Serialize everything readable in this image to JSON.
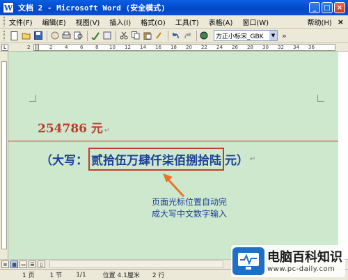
{
  "window": {
    "title": "文档 2 - Microsoft Word (安全模式)",
    "app_icon": "W",
    "buttons": [
      "_",
      "□",
      "×"
    ]
  },
  "menu": {
    "items": [
      "文件(F)",
      "编辑(E)",
      "视图(V)",
      "插入(I)",
      "格式(O)",
      "工具(T)",
      "表格(A)",
      "窗口(W)",
      "帮助(H)"
    ],
    "close": "×"
  },
  "toolbar": {
    "font_name": "方正小标宋_GBK"
  },
  "ruler": {
    "numbers": [
      "2",
      "2",
      "4",
      "6",
      "8",
      "10",
      "12",
      "14",
      "16",
      "18",
      "20",
      "22",
      "24",
      "26",
      "28",
      "30",
      "32",
      "34",
      "36"
    ]
  },
  "document": {
    "amount": "254786 元",
    "paragraph_mark": "↵",
    "daxie_open": "（大写：",
    "daxie_value": "贰拾伍万肆仟柒佰捌拾陆",
    "daxie_close": "元）",
    "note_line1": "页面光标位置自动完",
    "note_line2": "成大写中文数字输入"
  },
  "statusbar": {
    "page": "1 页",
    "section": "1 节",
    "page_of": "1/1",
    "position": "位置 4.1厘米",
    "line": "2 行"
  },
  "watermark": {
    "brand": "电脑百科知识",
    "url": "www.pc-daily.com"
  },
  "colors": {
    "titlebar": "#0347c8",
    "document_bg": "#cde8cc",
    "amount_text": "#c0392b",
    "daxie_text": "#1d3f9a",
    "highlight_box": "#c23a2a",
    "annotation_arrow": "#e8742a"
  }
}
